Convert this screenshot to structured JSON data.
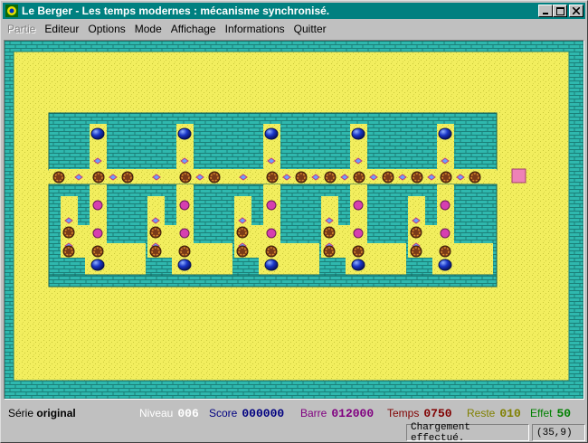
{
  "window": {
    "title": "Le Berger - Les temps modernes : mécanisme synchronisé.",
    "colors": {
      "titlebar": "#008080",
      "chrome": "#c0c0c0"
    }
  },
  "menu": {
    "items": [
      {
        "label": "Partie",
        "enabled": false
      },
      {
        "label": "Editeur",
        "enabled": true
      },
      {
        "label": "Options",
        "enabled": true
      },
      {
        "label": "Mode",
        "enabled": true
      },
      {
        "label": "Affichage",
        "enabled": true
      },
      {
        "label": "Informations",
        "enabled": true
      },
      {
        "label": "Quitter",
        "enabled": true
      }
    ]
  },
  "game": {
    "colors": {
      "sand": "#f2ee5e",
      "wall": "#2fb8ae",
      "wall_mortar": "#1b7f78",
      "blue_ball": "#1936c8",
      "ring_ball": "#d88a2c",
      "magenta_dot": "#d63fb0",
      "target_square": "#ee82b6"
    },
    "tile_legend": [
      "wall",
      "sand",
      "blue-ball",
      "ring-ball",
      "magenta-dot",
      "diamond-marker",
      "target-square"
    ]
  },
  "status": {
    "serie_label": "Série",
    "serie_value": "original",
    "niveau_label": "Niveau",
    "niveau_value": "006",
    "niveau_color": "#ffffff",
    "score_label": "Score",
    "score_value": "000000",
    "score_color": "#000080",
    "barre_label": "Barre",
    "barre_value": "012000",
    "barre_color": "#800080",
    "temps_label": "Temps",
    "temps_value": "0750",
    "temps_color": "#800000",
    "reste_label": "Reste",
    "reste_value": "010",
    "reste_color": "#808000",
    "effet_label": "Effet",
    "effet_value": "50",
    "effet_color": "#008000"
  },
  "message": {
    "text": "Chargement effectué.",
    "coords": "(35,9)"
  }
}
